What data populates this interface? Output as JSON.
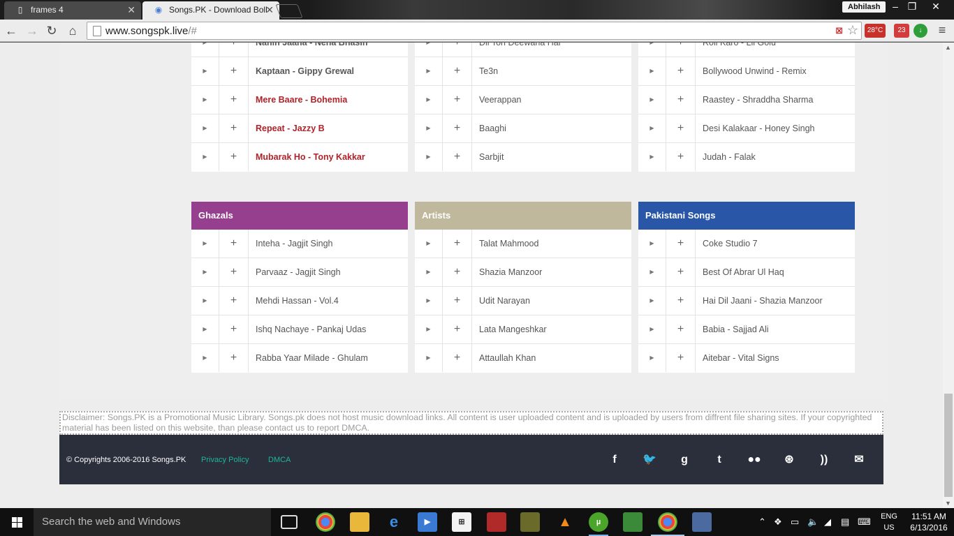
{
  "browser": {
    "tabs": [
      {
        "title": "frames 4",
        "icon": "document-icon"
      },
      {
        "title": "Songs.PK - Download Boll",
        "icon": "chrome-icon"
      }
    ],
    "user": "Abhilash",
    "url_host": "www.songspk.live",
    "url_path": "/#",
    "extensions": [
      {
        "name": "weather",
        "label": "28°C"
      },
      {
        "name": "badge",
        "label": "23"
      }
    ]
  },
  "columns": [
    {
      "heading": "",
      "rows": [
        {
          "title": "Nahin Jaana - Neha Bhasin",
          "style": "bold"
        },
        {
          "title": "Kaptaan - Gippy Grewal",
          "style": "bold"
        },
        {
          "title": "Mere Baare - Bohemia",
          "style": "red"
        },
        {
          "title": "Repeat - Jazzy B",
          "style": "red"
        },
        {
          "title": "Mubarak Ho - Tony Kakkar",
          "style": "red"
        }
      ]
    },
    {
      "heading": "",
      "rows": [
        {
          "title": "Dil Toh Deewana Hai",
          "style": ""
        },
        {
          "title": "Te3n",
          "style": ""
        },
        {
          "title": "Veerappan",
          "style": ""
        },
        {
          "title": "Baaghi",
          "style": ""
        },
        {
          "title": "Sarbjit",
          "style": ""
        }
      ]
    },
    {
      "heading": "",
      "rows": [
        {
          "title": "Roll Karo - Lil Golu",
          "style": ""
        },
        {
          "title": "Bollywood Unwind - Remix",
          "style": ""
        },
        {
          "title": "Raastey - Shraddha Sharma",
          "style": ""
        },
        {
          "title": "Desi Kalakaar - Honey Singh",
          "style": ""
        },
        {
          "title": "Judah - Falak",
          "style": ""
        }
      ]
    },
    {
      "heading": "Ghazals",
      "color": "#953f8e",
      "rows": [
        {
          "title": "Inteha - Jagjit Singh",
          "style": ""
        },
        {
          "title": "Parvaaz - Jagjit Singh",
          "style": ""
        },
        {
          "title": "Mehdi Hassan - Vol.4",
          "style": ""
        },
        {
          "title": "Ishq Nachaye - Pankaj Udas",
          "style": ""
        },
        {
          "title": "Rabba Yaar Milade - Ghulam",
          "style": ""
        }
      ]
    },
    {
      "heading": "Artists",
      "color": "#bfb89c",
      "rows": [
        {
          "title": "Talat Mahmood",
          "style": ""
        },
        {
          "title": "Shazia Manzoor",
          "style": ""
        },
        {
          "title": "Udit Narayan",
          "style": ""
        },
        {
          "title": "Lata Mangeshkar",
          "style": ""
        },
        {
          "title": "Attaullah Khan",
          "style": ""
        }
      ]
    },
    {
      "heading": "Pakistani Songs",
      "color": "#2a56a8",
      "rows": [
        {
          "title": "Coke Studio 7",
          "style": ""
        },
        {
          "title": "Best Of Abrar Ul Haq",
          "style": ""
        },
        {
          "title": "Hai Dil Jaani - Shazia Manzoor",
          "style": ""
        },
        {
          "title": "Babia - Sajjad Ali",
          "style": ""
        },
        {
          "title": "Aitebar - Vital Signs",
          "style": ""
        }
      ]
    }
  ],
  "disclaimer": "Disclaimer: Songs.PK is a Promotional Music Library. Songs.pk does not host music download links. All content is user uploaded content and is uploaded by users from diffrent file sharing sites. If your copyrighted material has been listed on this website, than please contact us to report DMCA.",
  "footer": {
    "copyright": "© Copyrights 2006-2016 Songs.PK",
    "links": [
      "Privacy Policy",
      "DMCA"
    ],
    "social": [
      {
        "name": "facebook-icon",
        "glyph": "f"
      },
      {
        "name": "twitter-icon",
        "glyph": "🐦"
      },
      {
        "name": "google-plus-icon",
        "glyph": "g"
      },
      {
        "name": "tumblr-icon",
        "glyph": "t"
      },
      {
        "name": "flickr-icon",
        "glyph": "●●"
      },
      {
        "name": "dribbble-icon",
        "glyph": "⊛"
      },
      {
        "name": "rss-icon",
        "glyph": "))"
      },
      {
        "name": "email-icon",
        "glyph": "✉"
      }
    ],
    "link_color": "#1fb59a"
  },
  "taskbar": {
    "search_placeholder": "Search the web and Windows",
    "lang_line1": "ENG",
    "lang_line2": "US",
    "time": "11:51 AM",
    "date": "6/13/2016"
  }
}
